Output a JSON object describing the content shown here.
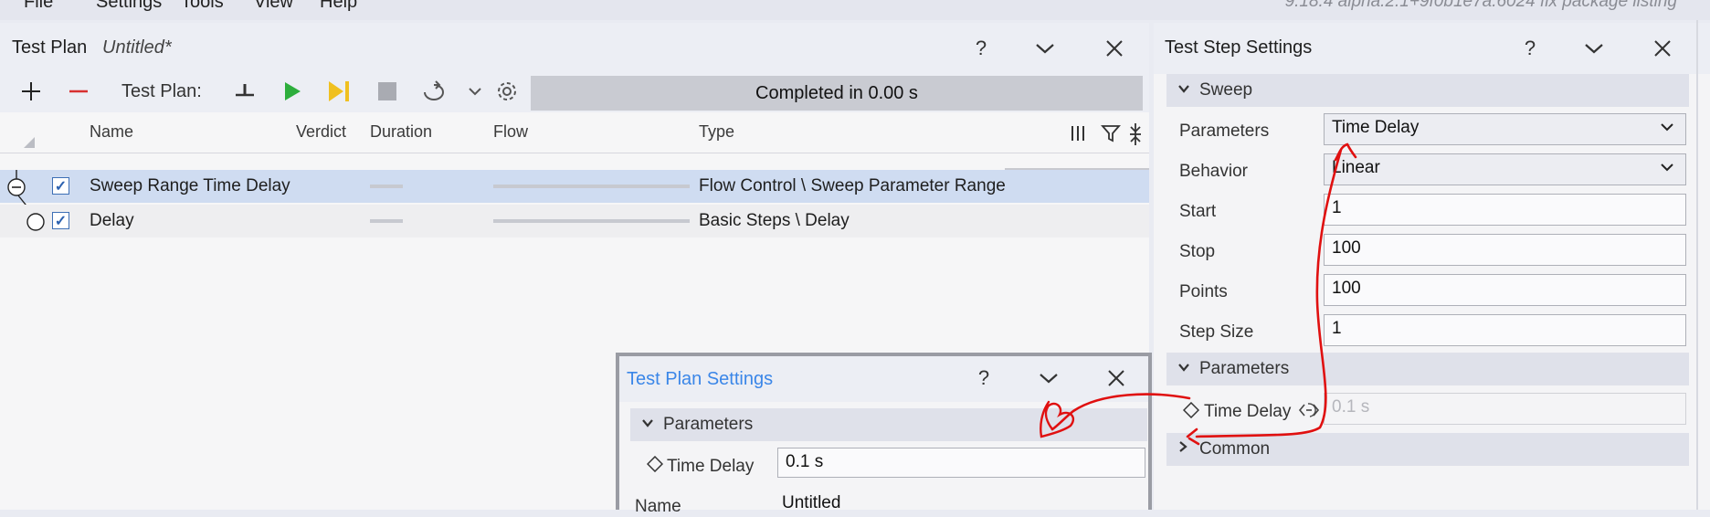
{
  "menu": {
    "items": [
      "File",
      "Settings",
      "Tools",
      "View",
      "Help"
    ],
    "version": "9.18.4 alpha.2.1+9f0b1e7a.6024 fix package listing"
  },
  "test_plan": {
    "title": "Test Plan",
    "subtitle": "Untitled*",
    "toolbar": {
      "label": "Test Plan:",
      "status": "Completed in 0.00 s"
    },
    "columns": [
      "Name",
      "Verdict",
      "Duration",
      "Flow",
      "Type"
    ],
    "rows": [
      {
        "name": "Sweep Range Time Delay",
        "type": "Flow Control \\ Sweep Parameter Range",
        "checked": true
      },
      {
        "name": "Delay",
        "type": "Basic Steps \\ Delay",
        "checked": true
      }
    ]
  },
  "step_settings": {
    "title": "Test Step Settings",
    "sections": {
      "sweep": "Sweep",
      "parameters": "Parameters",
      "common": "Common"
    },
    "props": {
      "parameters": {
        "label": "Parameters",
        "value": "Time Delay"
      },
      "behavior": {
        "label": "Behavior",
        "value": "Linear"
      },
      "start": {
        "label": "Start",
        "value": "1"
      },
      "stop": {
        "label": "Stop",
        "value": "100"
      },
      "points": {
        "label": "Points",
        "value": "100"
      },
      "step_size": {
        "label": "Step Size",
        "value": "1"
      },
      "time_delay": {
        "label": "Time Delay",
        "value": "0.1 s"
      }
    }
  },
  "plan_settings": {
    "title": "Test Plan Settings",
    "section": "Parameters",
    "time_delay": {
      "label": "Time Delay",
      "value": "0.1 s"
    },
    "name": {
      "label": "Name",
      "value": "Untitled"
    }
  },
  "colors": {
    "accent": "#3a86e8",
    "selection": "#cfdcf1",
    "annotation": "#e01010"
  }
}
